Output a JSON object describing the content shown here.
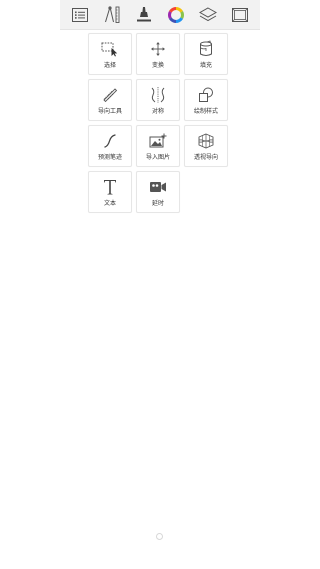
{
  "toolbar": {
    "items": [
      {
        "icon": "list-icon"
      },
      {
        "icon": "ruler-compass-icon"
      },
      {
        "icon": "brush-icon"
      },
      {
        "icon": "color-wheel-icon"
      },
      {
        "icon": "layers-icon"
      },
      {
        "icon": "canvas-icon"
      }
    ]
  },
  "tools": [
    {
      "label": "选择",
      "icon": "selection-icon"
    },
    {
      "label": "变换",
      "icon": "transform-icon"
    },
    {
      "label": "填充",
      "icon": "fill-bucket-icon"
    },
    {
      "label": "导向工具",
      "icon": "ruler-guide-icon"
    },
    {
      "label": "对称",
      "icon": "symmetry-icon"
    },
    {
      "label": "绘制样式",
      "icon": "shape-style-icon"
    },
    {
      "label": "预测笔迹",
      "icon": "predictive-stroke-icon"
    },
    {
      "label": "导入图片",
      "icon": "import-image-icon"
    },
    {
      "label": "透视导向",
      "icon": "perspective-guide-icon"
    },
    {
      "label": "文本",
      "icon": "text-icon"
    },
    {
      "label": "延时",
      "icon": "timelapse-icon"
    }
  ],
  "colors": {
    "toolbar_bg": "#f2f2f2",
    "icon": "#555555",
    "label": "#333333",
    "tile_border": "#e6e6e6"
  }
}
